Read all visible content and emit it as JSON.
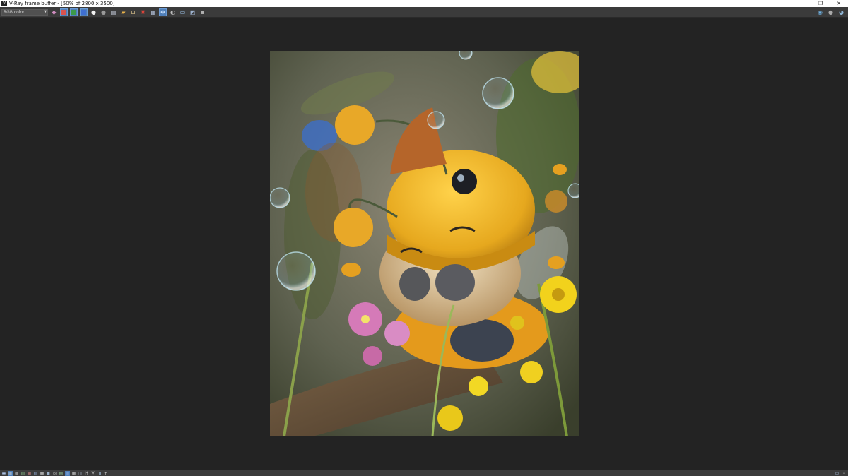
{
  "window": {
    "title": "V-Ray frame buffer - [50% of 2800 x 3500]",
    "app_icon": "V",
    "controls": {
      "minimize": "–",
      "restore": "❐",
      "close": "✕"
    }
  },
  "toolbar": {
    "channel_select": {
      "value": "RGB color"
    },
    "buttons": [
      {
        "name": "channels-icon",
        "glyph": "◆",
        "color": "#d08cc0",
        "active": false
      },
      {
        "name": "red-channel-icon",
        "glyph": "",
        "color": "#d9534f",
        "active": true
      },
      {
        "name": "green-channel-icon",
        "glyph": "",
        "color": "#3c9a4a",
        "active": true
      },
      {
        "name": "blue-channel-icon",
        "glyph": "",
        "color": "#3f6fd1",
        "active": true
      },
      {
        "name": "white-dot-icon",
        "glyph": "●",
        "color": "#f2f2f2",
        "active": false
      },
      {
        "name": "grey-dot-icon",
        "glyph": "●",
        "color": "#9a9a9a",
        "active": false
      },
      {
        "name": "save-icon",
        "glyph": "▤",
        "color": "#cfd6e6",
        "active": false
      },
      {
        "name": "open-folder-icon",
        "glyph": "▰",
        "color": "#e8b24a",
        "active": false
      },
      {
        "name": "clear-icon",
        "glyph": "⊔",
        "color": "#d8c08a",
        "active": false
      },
      {
        "name": "stop-render-icon",
        "glyph": "✖",
        "color": "#e0443a",
        "active": false
      },
      {
        "name": "region-icon",
        "glyph": "▦",
        "color": "#b8c6e0",
        "active": false
      },
      {
        "name": "track-mouse-icon",
        "glyph": "✥",
        "color": "#cfe4ff",
        "active": true
      },
      {
        "name": "history-icon",
        "glyph": "◐",
        "color": "#bdbdbd",
        "active": false
      },
      {
        "name": "display-icon",
        "glyph": "▭",
        "color": "#9cc3ea",
        "active": false
      },
      {
        "name": "vfb-settings-icon",
        "glyph": "◩",
        "color": "#9fb3cf",
        "active": false
      },
      {
        "name": "lens-effects-icon",
        "glyph": "▪",
        "color": "#b0b0b0",
        "active": false
      }
    ],
    "right_buttons": [
      {
        "name": "teapot-icon",
        "glyph": "◉",
        "color": "#6fb0e0"
      },
      {
        "name": "sphere-icon",
        "glyph": "●",
        "color": "#aaaaaa"
      },
      {
        "name": "render-icon",
        "glyph": "◕",
        "color": "#8fb6d6"
      }
    ]
  },
  "statusbar": {
    "buttons": [
      {
        "name": "corrections-icon",
        "glyph": "▬",
        "color": "#a9bfe0",
        "active": false
      },
      {
        "name": "levels-icon",
        "glyph": "▥",
        "color": "#d0d0d0",
        "active": true
      },
      {
        "name": "exposure-icon",
        "glyph": "◍",
        "color": "#e0e0e0",
        "active": false
      },
      {
        "name": "white-balance-icon",
        "glyph": "▨",
        "color": "#7fb07f",
        "active": false
      },
      {
        "name": "hue-icon",
        "glyph": "▩",
        "color": "#c97f7f",
        "active": false
      },
      {
        "name": "color-balance-icon",
        "glyph": "▧",
        "color": "#8da5cf",
        "active": false
      },
      {
        "name": "curves-icon",
        "glyph": "▦",
        "color": "#cfcfcf",
        "active": false
      },
      {
        "name": "bg-image-icon",
        "glyph": "▣",
        "color": "#9ab0c8",
        "active": false
      },
      {
        "name": "lut-icon",
        "glyph": "◎",
        "color": "#cfcfcf",
        "active": false
      },
      {
        "name": "icc-icon",
        "glyph": "▤",
        "color": "#8fc08f",
        "active": false
      },
      {
        "name": "ocio-icon",
        "glyph": "▥",
        "color": "#8fa8d8",
        "active": true
      },
      {
        "name": "srgb-icon",
        "glyph": "▦",
        "color": "#c0c0c0",
        "active": false
      },
      {
        "name": "compare-icon",
        "glyph": "◫",
        "color": "#9aa6b8",
        "active": false
      },
      {
        "name": "h-icon",
        "glyph": "H",
        "color": "#d0d0d0",
        "active": false
      },
      {
        "name": "v-icon",
        "glyph": "V",
        "color": "#d0d0d0",
        "active": false
      },
      {
        "name": "ab-icon",
        "glyph": "◨",
        "color": "#9ab6cf",
        "active": false
      },
      {
        "name": "plus-icon",
        "glyph": "+",
        "color": "#d0d0d0",
        "active": false
      }
    ],
    "right_buttons": [
      {
        "name": "window-icon",
        "glyph": "▭",
        "color": "#a7c0e0"
      },
      {
        "name": "info-icon",
        "glyph": "⋯",
        "color": "#c8c8c8"
      }
    ]
  }
}
